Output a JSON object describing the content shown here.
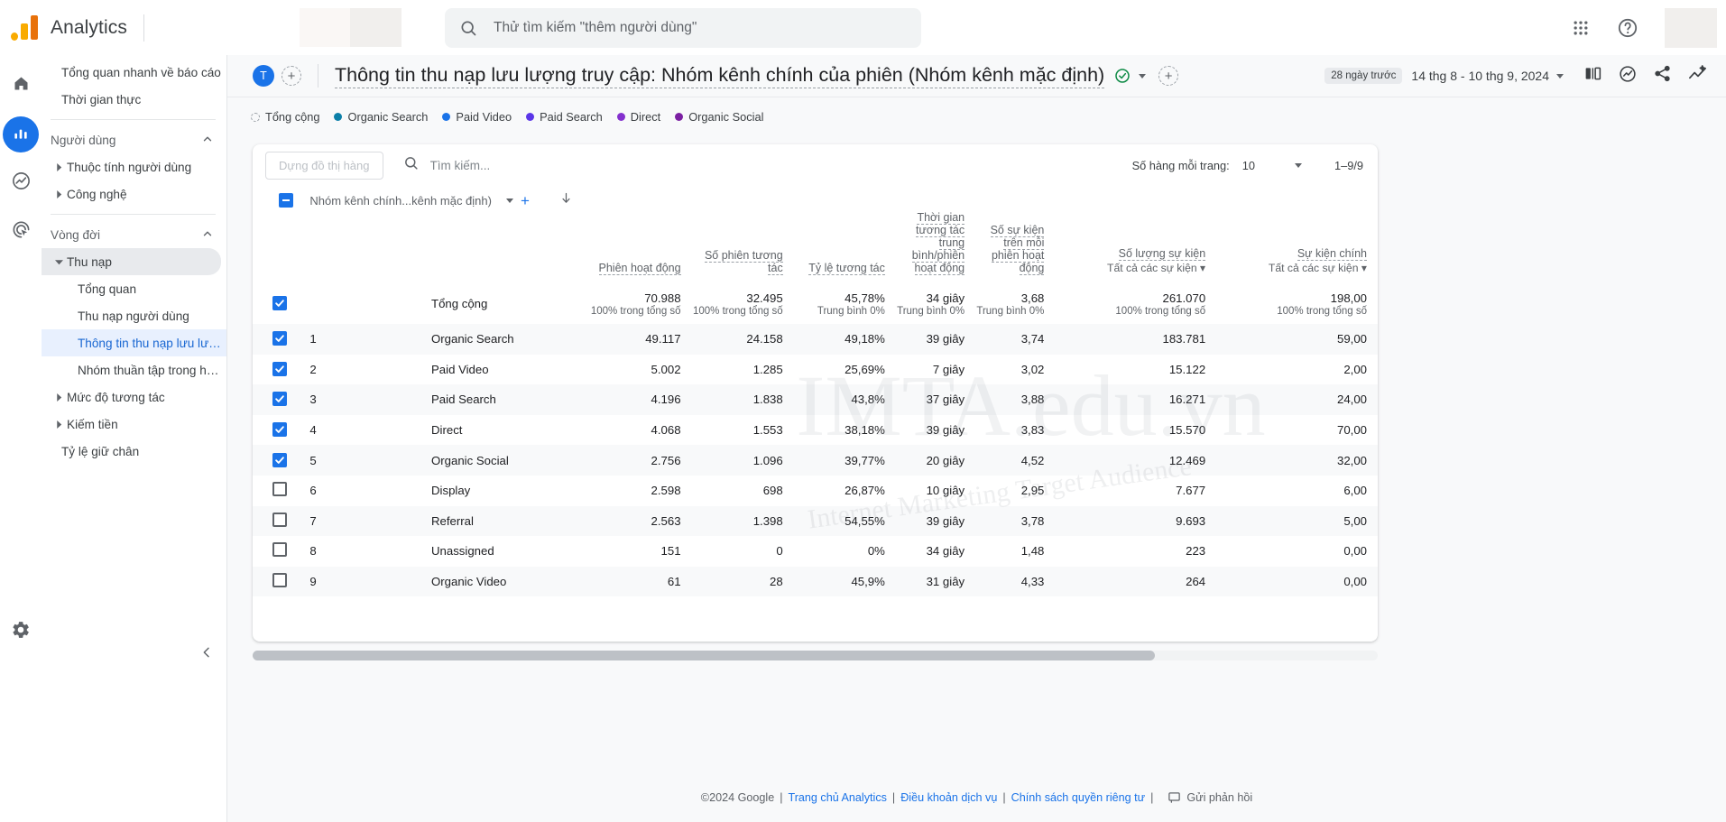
{
  "topbar": {
    "brand": "Analytics",
    "search_placeholder": "Thử tìm kiếm \"thêm người dùng\"",
    "apps_icon": "apps-grid-icon",
    "help_icon": "help-circle-icon"
  },
  "rail": {
    "items": [
      {
        "name": "home",
        "icon": "home-icon",
        "active": false
      },
      {
        "name": "reports",
        "icon": "bar-chart-icon",
        "active": true
      },
      {
        "name": "explore",
        "icon": "explore-icon",
        "active": false
      },
      {
        "name": "advertising",
        "icon": "advertising-icon",
        "active": false
      }
    ],
    "settings_icon": "gear-icon"
  },
  "sidebar": {
    "items": [
      {
        "label": "Tổng quan nhanh về báo cáo",
        "type": "top",
        "state": "none"
      },
      {
        "label": "Thời gian thực",
        "type": "top",
        "state": "none"
      },
      {
        "label": "Người dùng",
        "type": "section",
        "state": "expanded"
      },
      {
        "label": "Thuộc tính người dùng",
        "type": "group",
        "state": "collapsed"
      },
      {
        "label": "Công nghệ",
        "type": "group",
        "state": "collapsed"
      },
      {
        "label": "Vòng đời",
        "type": "section",
        "state": "expanded"
      },
      {
        "label": "Thu nạp",
        "type": "group",
        "state": "expanded"
      },
      {
        "label": "Tổng quan",
        "type": "sub",
        "state": "none"
      },
      {
        "label": "Thu nạp người dùng",
        "type": "sub",
        "state": "none"
      },
      {
        "label": "Thông tin thu nạp lưu lượn...",
        "type": "sub",
        "state": "selected"
      },
      {
        "label": "Nhóm thuần tập trong hoạ...",
        "type": "sub",
        "state": "none"
      },
      {
        "label": "Mức độ tương tác",
        "type": "group",
        "state": "collapsed"
      },
      {
        "label": "Kiếm tiền",
        "type": "group",
        "state": "collapsed"
      },
      {
        "label": "Tỷ lệ giữ chân",
        "type": "top",
        "state": "none"
      }
    ],
    "collapse_icon": "chevron-left-icon"
  },
  "report": {
    "avatar_initial": "T",
    "add_user_icon": "add-collaborator-icon",
    "title": "Thông tin thu nạp lưu lượng truy cập: Nhóm kênh chính của phiên (Nhóm kênh mặc định)",
    "verified_icon": "check-circle-icon",
    "add_icon": "add-comparison-icon",
    "date_badge": "28 ngày trước",
    "date_range": "14 thg 8 - 10 thg 9, 2024",
    "header_icons": [
      "compare-icon",
      "insights-icon",
      "share-icon",
      "trend-icon"
    ]
  },
  "legend": [
    {
      "label": "Tổng cộng",
      "color": "#9aa0a6",
      "dashed": true
    },
    {
      "label": "Organic Search",
      "color": "#0b7fa8"
    },
    {
      "label": "Paid Video",
      "color": "#1a73e8"
    },
    {
      "label": "Paid Search",
      "color": "#5b36e8"
    },
    {
      "label": "Direct",
      "color": "#8430ce"
    },
    {
      "label": "Organic Social",
      "color": "#7b1fa2"
    }
  ],
  "table_toolbar": {
    "plot_rows_button": "Dựng đồ thị hàng",
    "search_placeholder": "Tìm kiếm...",
    "rows_per_page_label": "Số hàng mỗi trang:",
    "rows_per_page_value": "10",
    "range": "1–9/9"
  },
  "table": {
    "dimension_header": "Nhóm kênh chính...kênh mặc định)",
    "sort_icon": "sort-descending-icon",
    "columns": [
      {
        "label": "Phiên hoạt động",
        "sub": ""
      },
      {
        "label": "Số phiên tương tác",
        "sub": ""
      },
      {
        "label": "Tỷ lệ tương tác",
        "sub": ""
      },
      {
        "label": "Thời gian tương tác trung bình/phiên hoạt động",
        "sub": ""
      },
      {
        "label": "Số sự kiện trên mỗi phiên hoạt động",
        "sub": ""
      },
      {
        "label": "Số lượng sự kiện",
        "sub": "Tất cả các sự kiện"
      },
      {
        "label": "Sự kiện chính",
        "sub": "Tất cả các sự kiện"
      }
    ],
    "total_row": {
      "label": "Tổng cộng",
      "checked": true,
      "values": [
        "70.988",
        "32.495",
        "45,78%",
        "34 giây",
        "3,68",
        "261.070",
        "198,00"
      ],
      "notes": [
        "100% trong tổng số",
        "100% trong tổng số",
        "Trung bình 0%",
        "Trung bình 0%",
        "Trung bình 0%",
        "100% trong tổng số",
        "100% trong tổng số"
      ]
    },
    "rows": [
      {
        "idx": "1",
        "name": "Organic Search",
        "checked": true,
        "values": [
          "49.117",
          "24.158",
          "49,18%",
          "39 giây",
          "3,74",
          "183.781",
          "59,00"
        ]
      },
      {
        "idx": "2",
        "name": "Paid Video",
        "checked": true,
        "values": [
          "5.002",
          "1.285",
          "25,69%",
          "7 giây",
          "3,02",
          "15.122",
          "2,00"
        ]
      },
      {
        "idx": "3",
        "name": "Paid Search",
        "checked": true,
        "values": [
          "4.196",
          "1.838",
          "43,8%",
          "37 giây",
          "3,88",
          "16.271",
          "24,00"
        ]
      },
      {
        "idx": "4",
        "name": "Direct",
        "checked": true,
        "values": [
          "4.068",
          "1.553",
          "38,18%",
          "39 giây",
          "3,83",
          "15.570",
          "70,00"
        ]
      },
      {
        "idx": "5",
        "name": "Organic Social",
        "checked": true,
        "values": [
          "2.756",
          "1.096",
          "39,77%",
          "20 giây",
          "4,52",
          "12.469",
          "32,00"
        ]
      },
      {
        "idx": "6",
        "name": "Display",
        "checked": false,
        "values": [
          "2.598",
          "698",
          "26,87%",
          "10 giây",
          "2,95",
          "7.677",
          "6,00"
        ]
      },
      {
        "idx": "7",
        "name": "Referral",
        "checked": false,
        "values": [
          "2.563",
          "1.398",
          "54,55%",
          "39 giây",
          "3,78",
          "9.693",
          "5,00"
        ]
      },
      {
        "idx": "8",
        "name": "Unassigned",
        "checked": false,
        "values": [
          "151",
          "0",
          "0%",
          "34 giây",
          "1,48",
          "223",
          "0,00"
        ]
      },
      {
        "idx": "9",
        "name": "Organic Video",
        "checked": false,
        "values": [
          "61",
          "28",
          "45,9%",
          "31 giây",
          "4,33",
          "264",
          "0,00"
        ]
      }
    ]
  },
  "footer": {
    "copyright": "©2024 Google",
    "links": [
      "Trang chủ Analytics",
      "Điều khoản dịch vụ",
      "Chính sách quyền riêng tư"
    ],
    "feedback": "Gửi phản hồi",
    "feedback_icon": "feedback-icon"
  }
}
